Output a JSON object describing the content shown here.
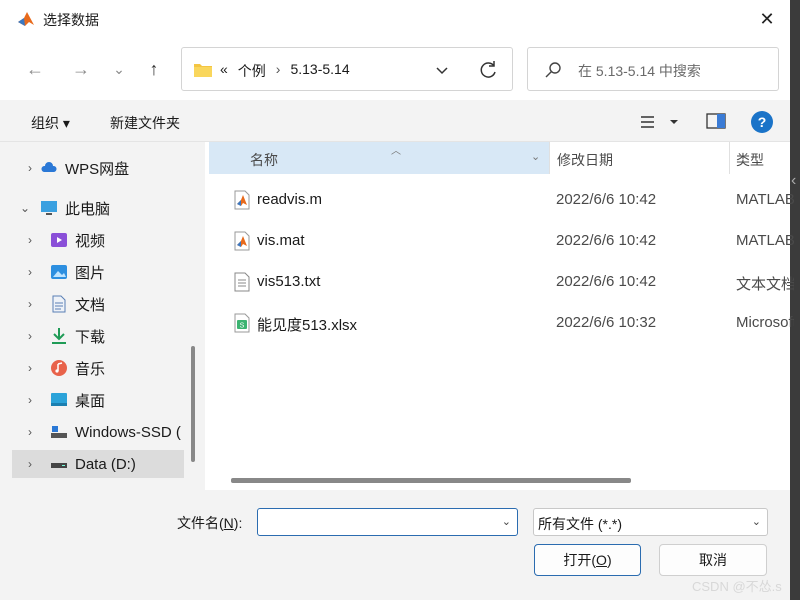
{
  "window": {
    "title": "选择数据",
    "close_glyph": "✕"
  },
  "nav": {
    "back_glyph": "←",
    "forward_glyph": "→",
    "history_glyph": "⌄",
    "up_glyph": "↑"
  },
  "address": {
    "prefix": "«",
    "crumbs": [
      "个例",
      "5.13-5.14"
    ],
    "separator": "›"
  },
  "search": {
    "placeholder": "在 5.13-5.14 中搜索"
  },
  "toolbar": {
    "organize_label": "组织 ▾",
    "new_folder_label": "新建文件夹",
    "help_label": "?"
  },
  "sidebar": {
    "items": [
      {
        "label": "WPS网盘",
        "icon": "cloud-icon",
        "indent": 0
      },
      {
        "label": "此电脑",
        "icon": "computer-icon",
        "indent": 0,
        "expanded": true
      },
      {
        "label": "视频",
        "icon": "video-icon",
        "indent": 1
      },
      {
        "label": "图片",
        "icon": "picture-icon",
        "indent": 1
      },
      {
        "label": "文档",
        "icon": "document-icon",
        "indent": 1
      },
      {
        "label": "下载",
        "icon": "download-icon",
        "indent": 1
      },
      {
        "label": "音乐",
        "icon": "music-icon",
        "indent": 1
      },
      {
        "label": "桌面",
        "icon": "desktop-icon",
        "indent": 1
      },
      {
        "label": "Windows-SSD (",
        "icon": "drive-icon",
        "indent": 1
      },
      {
        "label": "Data (D:)",
        "icon": "drive-icon",
        "indent": 1,
        "selected": true
      }
    ]
  },
  "columns": {
    "name": "名称",
    "date": "修改日期",
    "type": "类型"
  },
  "files": [
    {
      "name": "readvis.m",
      "date": "2022/6/6 10:42",
      "type": "MATLAB",
      "icon": "matlab-file-icon"
    },
    {
      "name": "vis.mat",
      "date": "2022/6/6 10:42",
      "type": "MATLAB",
      "icon": "matlab-file-icon"
    },
    {
      "name": "vis513.txt",
      "date": "2022/6/6 10:42",
      "type": "文本文档",
      "icon": "text-file-icon"
    },
    {
      "name": "能见度513.xlsx",
      "date": "2022/6/6 10:32",
      "type": "Microsoft",
      "icon": "excel-file-icon"
    }
  ],
  "footer": {
    "filename_label": "文件名(",
    "filename_key": "N",
    "filename_label_end": "):",
    "filename_value": "",
    "filetype_value": "所有文件 (*.*)",
    "open_label": "打开(",
    "open_key": "O",
    "open_label_end": ")",
    "cancel_label": "取消"
  },
  "watermark": "CSDN @不怂.s"
}
